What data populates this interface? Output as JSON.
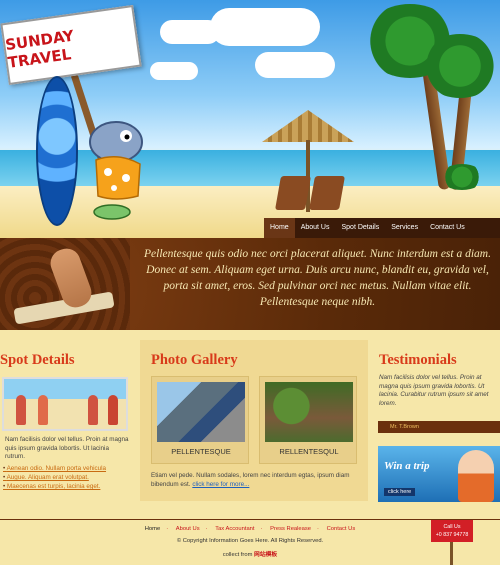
{
  "header": {
    "sign_text": "SUNDAY TRAVEL",
    "nav": [
      "Home",
      "About Us",
      "Spot Details",
      "Services",
      "Contact Us"
    ]
  },
  "banner": {
    "text": "Pellentesque quis odio nec orci placerat aliquet. Nunc interdum est a diam. Donec at sem. Aliquam eget urna. Duis arcu nunc, blandit eu, gravida vel, porta sit amet, eros. Sed pulvinar orci nec metus. Nullam vitae elit. Pellentesque neque nibh."
  },
  "spot": {
    "title": "Spot Details",
    "desc": "Nam facilisis dolor vel tellus. Proin at magna quis ipsum gravida lobortis. Ut lacinia rutrum.",
    "links": [
      "Aenean odio. Nullam porta vehicula",
      "Augue. Aliquam erat volutpat.",
      "Maecenas est turpis, lacinia eget."
    ]
  },
  "gallery": {
    "title": "Photo Gallery",
    "items": [
      {
        "caption": "PELLENTESQUE"
      },
      {
        "caption": "RELLENTESQUL"
      }
    ],
    "desc": "Etiam vel pede. Nullam sodales, lorem nec interdum egtas, ipsum diam bibendum est.",
    "more": "click here for more..."
  },
  "testimonials": {
    "title": "Testimonials",
    "quote": "Nam facilisis dolor vel tellus. Proin at magna quis ipsum gravida lobortis. Ut lacinia. Curabitur rutrum ipsum sit amet lorem.",
    "author": "Mr. T.Brown",
    "ad_title": "Win a trip",
    "ad_button": "click here"
  },
  "footer": {
    "links": [
      "Home",
      "About Us",
      "Tax Accountant",
      "Press Realease",
      "Contact Us"
    ],
    "copyright": "© Copyright Information Goes Here. All Rights Reserved.",
    "collect_prefix": "collect from",
    "collect_site": "网站模板",
    "call_label": "Call Us",
    "phone": "+0 837 94778"
  }
}
